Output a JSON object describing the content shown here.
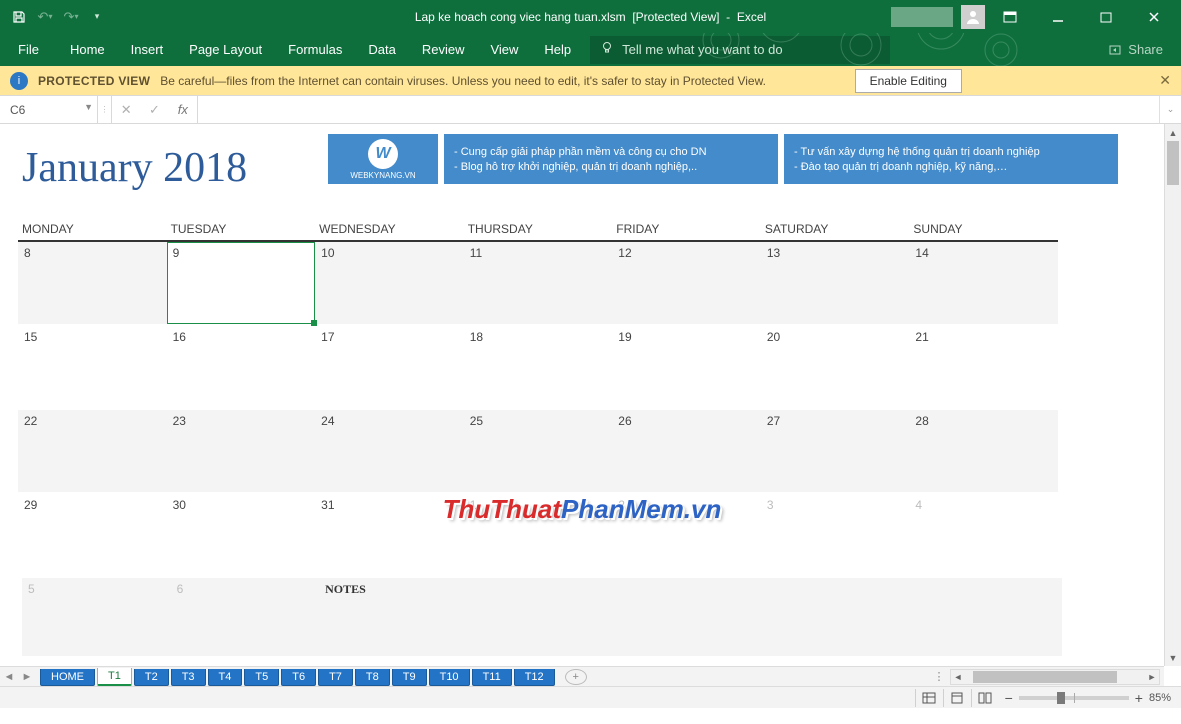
{
  "titlebar": {
    "filename": "Lap ke hoach cong viec hang tuan.xlsm",
    "mode": "[Protected View]",
    "dash": "-",
    "app": "Excel"
  },
  "ribbon": {
    "tabs": [
      "File",
      "Home",
      "Insert",
      "Page Layout",
      "Formulas",
      "Data",
      "Review",
      "View",
      "Help"
    ],
    "tell_me_placeholder": "Tell me what you want to do",
    "share": "Share"
  },
  "protected_view": {
    "title": "PROTECTED VIEW",
    "message": "Be careful—files from the Internet can contain viruses. Unless you need to edit, it's safer to stay in Protected View.",
    "button": "Enable Editing"
  },
  "formula_bar": {
    "name_box": "C6",
    "fx_symbol": "fx",
    "value": ""
  },
  "calendar": {
    "title": "January 2018",
    "day_headers": [
      "MONDAY",
      "TUESDAY",
      "WEDNESDAY",
      "THURSDAY",
      "FRIDAY",
      "SATURDAY",
      "SUNDAY"
    ],
    "rows": [
      [
        "8",
        "9",
        "10",
        "11",
        "12",
        "13",
        "14"
      ],
      [
        "15",
        "16",
        "17",
        "18",
        "19",
        "20",
        "21"
      ],
      [
        "22",
        "23",
        "24",
        "25",
        "26",
        "27",
        "28"
      ],
      [
        "29",
        "30",
        "31",
        "1",
        "2",
        "3",
        "4"
      ]
    ],
    "muted_index_start": 24,
    "notes_label": "NOTES",
    "overflow": [
      "5",
      "6"
    ]
  },
  "promo": {
    "logo_text": "WEBKYNANG.VN",
    "logo_letter": "W",
    "box1": [
      "- Cung cấp giải pháp phần mềm và công cụ cho DN",
      "- Blog hỗ trợ khởi nghiệp, quản trị doanh  nghiệp,.."
    ],
    "box2": [
      "- Tư vấn xây dựng hệ thống quản trị doanh nghiệp",
      "- Đào tạo quản trị doanh  nghiệp, kỹ năng,…"
    ]
  },
  "watermark": {
    "part1": "ThuThuat",
    "part2": "PhanMem.vn"
  },
  "sheet_tabs": {
    "home": "HOME",
    "active": "T1",
    "others": [
      "T2",
      "T3",
      "T4",
      "T5",
      "T6",
      "T7",
      "T8",
      "T9",
      "T10",
      "T11",
      "T12"
    ]
  },
  "status": {
    "zoom": "85%"
  }
}
